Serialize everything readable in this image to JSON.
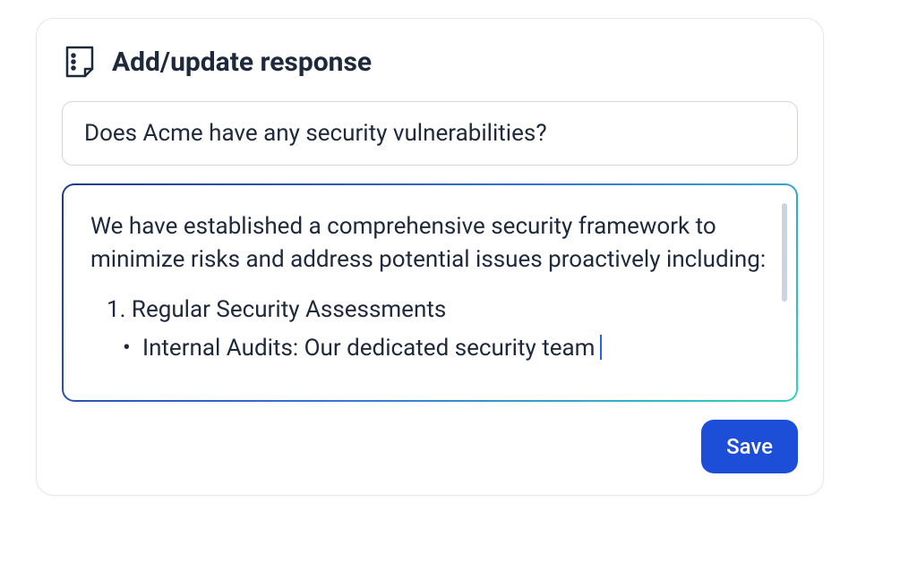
{
  "card": {
    "title": "Add/update response",
    "question": "Does Acme have any security vulnerabilities?",
    "response": {
      "intro": "We have established a comprehensive security framework to minimize risks and address potential issues proactively including:",
      "list_number": "1.",
      "list_item": "Regular Security Assessments",
      "bullet_item": "Internal Audits: Our dedicated security team"
    },
    "save_label": "Save"
  }
}
